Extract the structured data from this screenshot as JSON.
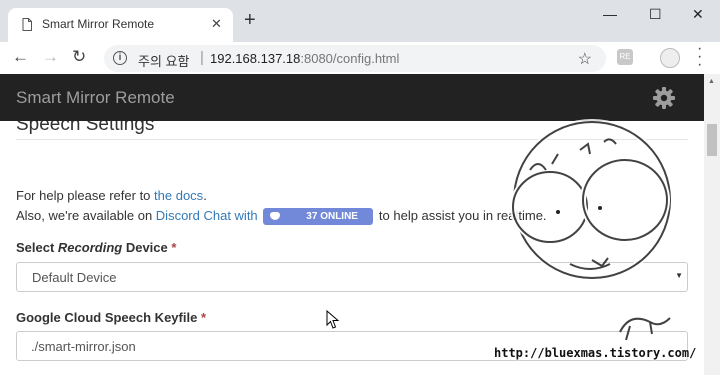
{
  "browser": {
    "tab_title": "Smart Mirror Remote",
    "tab_close": "✕",
    "new_tab": "+",
    "window_controls": {
      "minimize": "—",
      "maximize": "☐",
      "close": "✕"
    },
    "security_text": "주의 요함",
    "url_host": "192.168.137.18",
    "url_rest": ":8080/config.html",
    "ext_label": "RE"
  },
  "app": {
    "title": "Smart Mirror Remote",
    "section_title": "Speech Settings",
    "help": {
      "line1_prefix": "For help please refer to ",
      "docs_link": "the docs",
      "line1_suffix": ".",
      "line2_prefix": "Also, we're available on ",
      "discord_link": "Discord Chat with",
      "discord_badge": "37 ONLINE",
      "line2_suffix": " to help assist you in realtime."
    },
    "recording_label_pre": "Select ",
    "recording_label_em": "Recording",
    "recording_label_post": " Device",
    "recording_value": "Default Device",
    "keyfile_label": "Google Cloud Speech Keyfile",
    "required_mark": "*",
    "keyfile_value": "./smart-mirror.json"
  },
  "watermark": {
    "url": "http://bluexmas.tistory.com/"
  },
  "colors": {
    "appbar": "#222222",
    "link": "#337ab7",
    "discord": "#7289da",
    "required": "#a94442"
  }
}
